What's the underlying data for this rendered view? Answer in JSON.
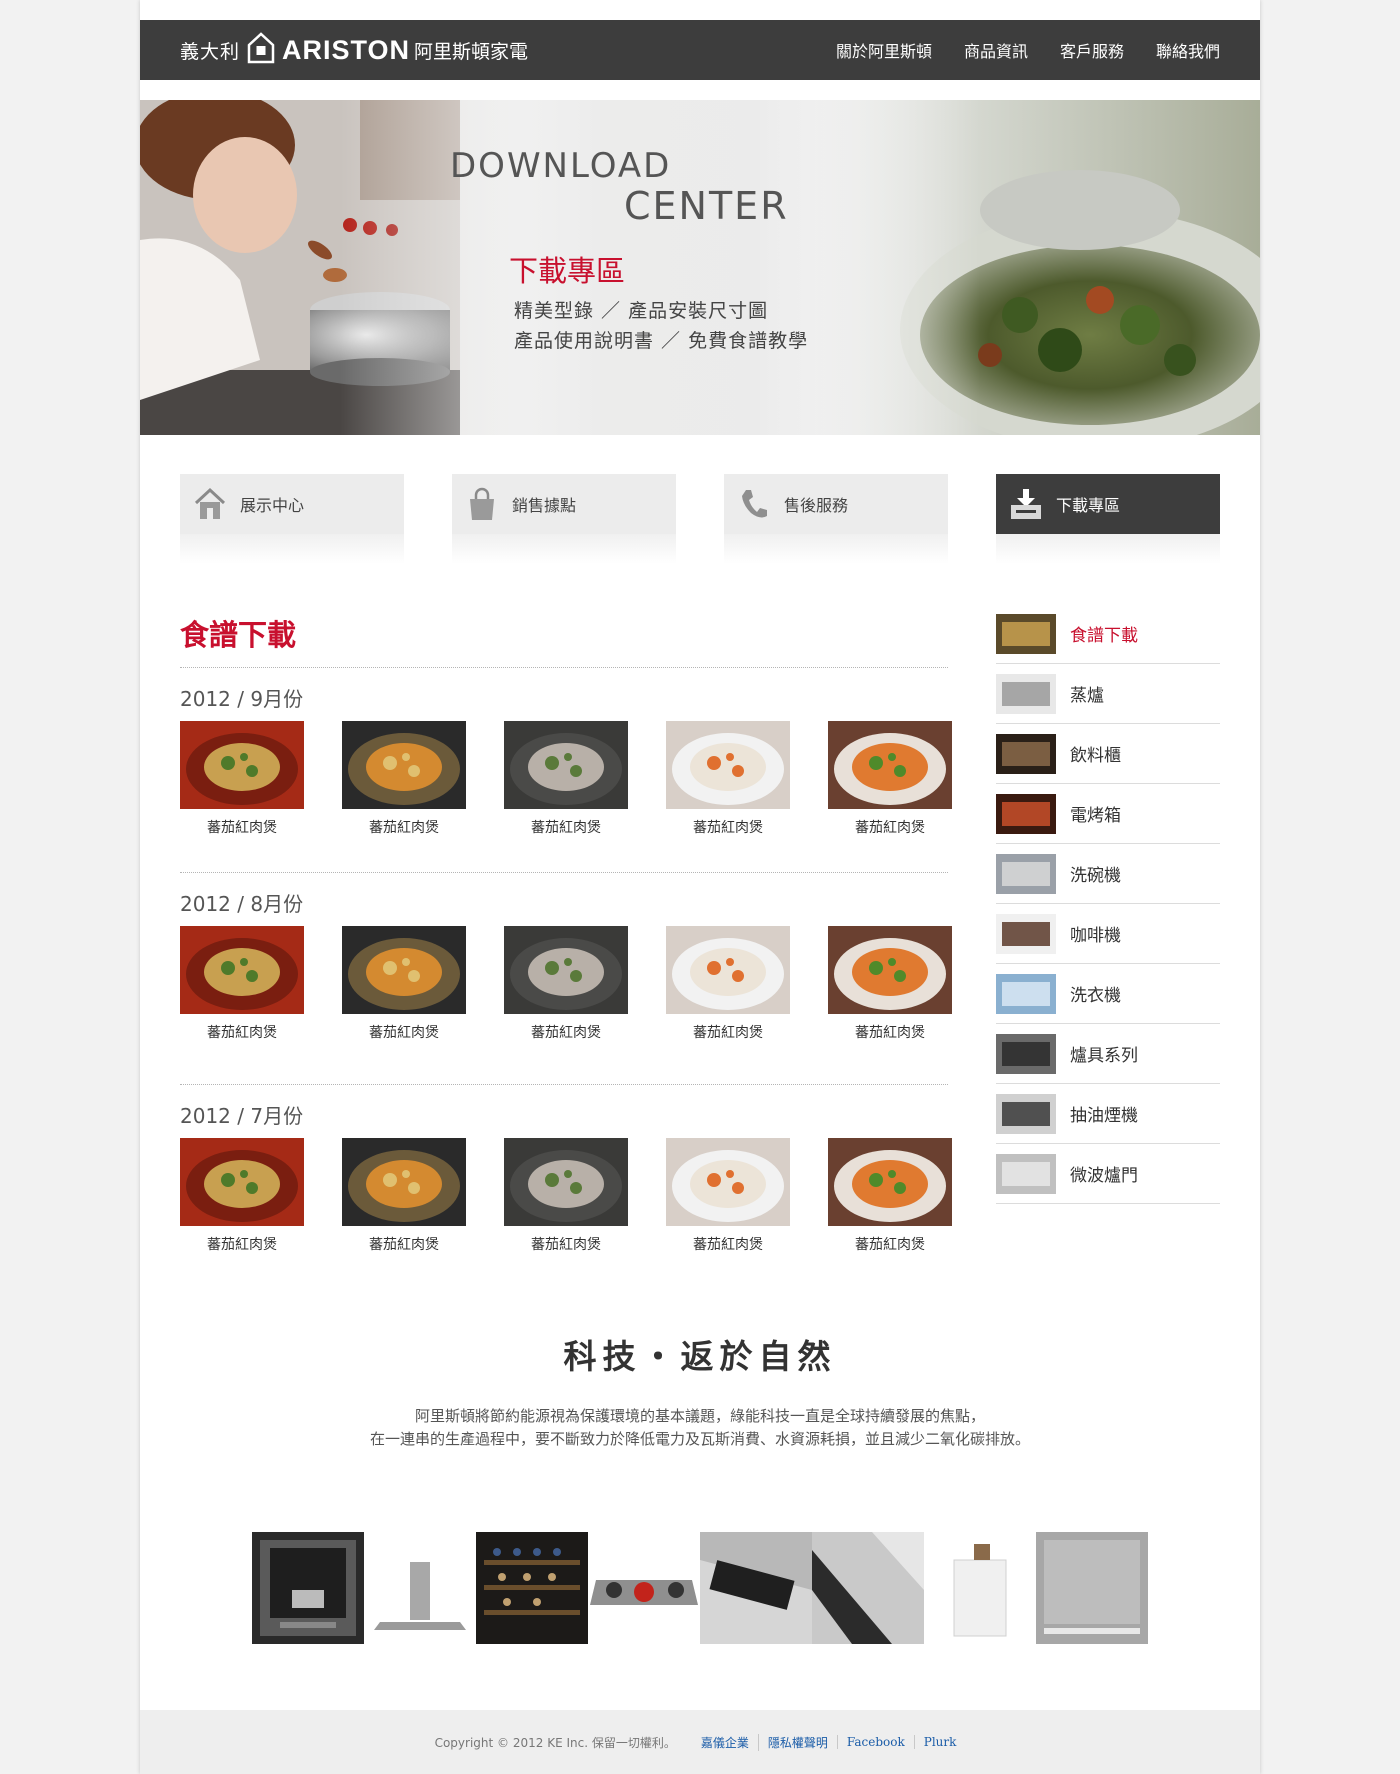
{
  "header": {
    "logo_cn_left": "義大利",
    "logo_brand": "ARISTON",
    "logo_cn_right": "阿里斯頓家電",
    "nav": [
      "關於阿里斯頓",
      "商品資訊",
      "客戶服務",
      "聯絡我們"
    ]
  },
  "hero": {
    "title_en_1": "DOWNLOAD",
    "title_en_2": "CENTER",
    "title_cn": "下載專區",
    "line1": "精美型錄 ／ 產品安裝尺寸圖",
    "line2": "產品使用說明書 ／ 免費食譜教學"
  },
  "tabs": [
    {
      "label": "展示中心",
      "icon": "house-icon"
    },
    {
      "label": "銷售據點",
      "icon": "shopping-bag-icon"
    },
    {
      "label": "售後服務",
      "icon": "phone-icon"
    },
    {
      "label": "下載專區",
      "icon": "download-icon",
      "active": true
    }
  ],
  "main": {
    "title": "食譜下載",
    "groups": [
      {
        "month": "2012 / 9月份",
        "items": [
          "蕃茄紅肉煲",
          "蕃茄紅肉煲",
          "蕃茄紅肉煲",
          "蕃茄紅肉煲",
          "蕃茄紅肉煲"
        ]
      },
      {
        "month": "2012 / 8月份",
        "items": [
          "蕃茄紅肉煲",
          "蕃茄紅肉煲",
          "蕃茄紅肉煲",
          "蕃茄紅肉煲",
          "蕃茄紅肉煲"
        ]
      },
      {
        "month": "2012 / 7月份",
        "items": [
          "蕃茄紅肉煲",
          "蕃茄紅肉煲",
          "蕃茄紅肉煲",
          "蕃茄紅肉煲",
          "蕃茄紅肉煲"
        ]
      }
    ]
  },
  "sidebar": {
    "items": [
      "食譜下載",
      "蒸爐",
      "飲料櫃",
      "電烤箱",
      "洗碗機",
      "咖啡機",
      "洗衣機",
      "爐具系列",
      "抽油煙機",
      "微波爐門"
    ],
    "active": "食譜下載"
  },
  "tagline": {
    "title": "科技・返於自然",
    "desc1": "阿里斯頓將節約能源視為保護環境的基本議題，綠能科技一直是全球持續發展的焦點，",
    "desc2": "在一連串的生產過程中，要不斷致力於降低電力及瓦斯消費、水資源耗損，並且減少二氧化碳排放。"
  },
  "footer": {
    "copyright": "Copyright © 2012 KE Inc. 保留一切權利。",
    "links": [
      "嘉儀企業",
      "隱私權聲明",
      "Facebook",
      "Plurk"
    ]
  },
  "colors": {
    "accent": "#c8102e",
    "header_bg": "#3d3d3d",
    "link": "#1a5ca8"
  }
}
